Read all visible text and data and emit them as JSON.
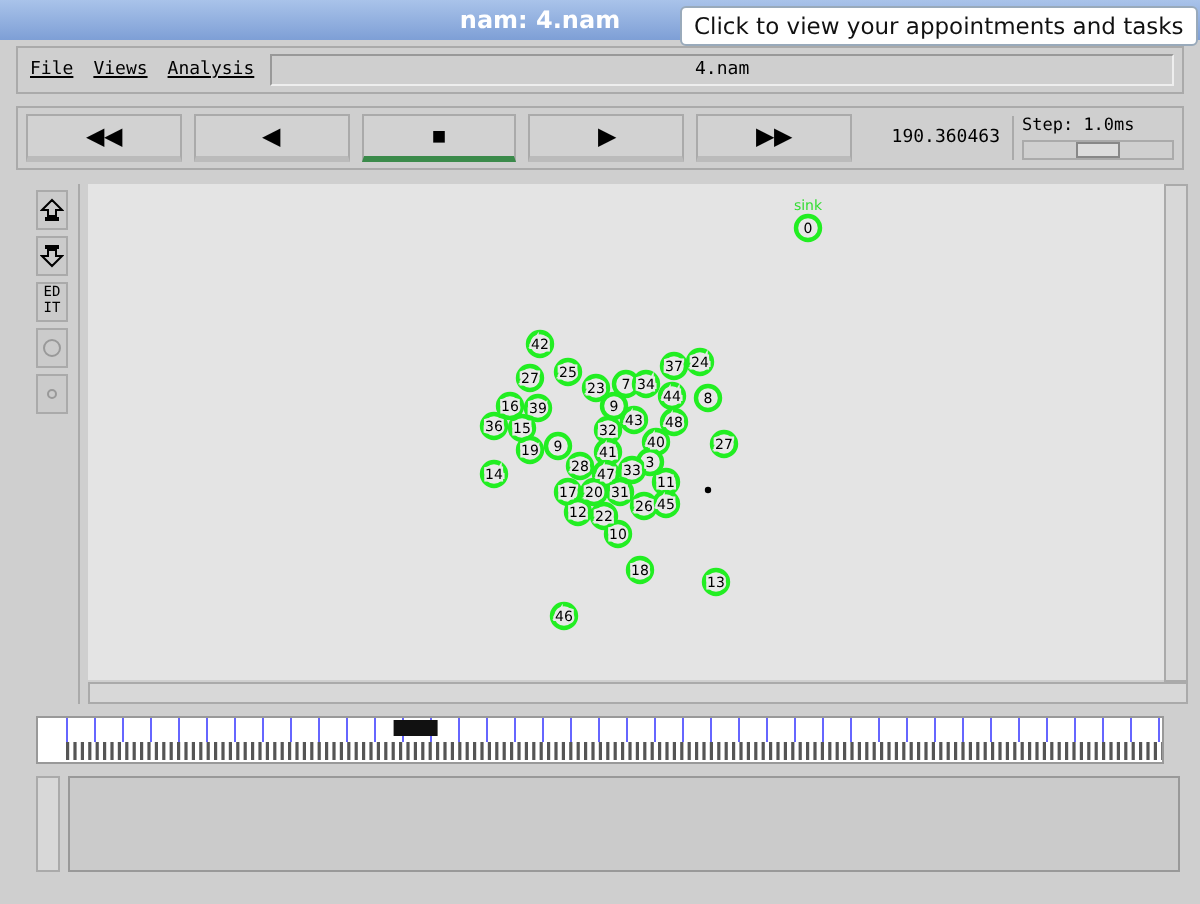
{
  "window": {
    "title": "nam: 4.nam"
  },
  "tooltip": {
    "text": "Click to view your appointments and tasks"
  },
  "menu": [
    "File",
    "Views",
    "Analysis"
  ],
  "file_field": {
    "value": "4.nam"
  },
  "playback": [
    {
      "symbol": "◀◀",
      "selected": false
    },
    {
      "symbol": "◀",
      "selected": false
    },
    {
      "symbol": "■",
      "selected": true
    },
    {
      "symbol": "▶",
      "selected": false
    },
    {
      "symbol": "▶▶",
      "selected": false
    }
  ],
  "time": "190.360463",
  "step": {
    "label": "Step: 1.0ms",
    "level": 0.5
  },
  "tools": [
    {
      "kind": "zoom-in"
    },
    {
      "kind": "zoom-out"
    },
    {
      "kind": "text",
      "label": "ED IT"
    },
    {
      "kind": "circle"
    },
    {
      "kind": "dot"
    }
  ],
  "nodes": [
    {
      "label": "0",
      "tag": "sink"
    },
    {
      "label": "42"
    },
    {
      "label": "27"
    },
    {
      "label": "25"
    },
    {
      "label": "37"
    },
    {
      "label": "24"
    },
    {
      "label": "23"
    },
    {
      "label": "7"
    },
    {
      "label": "9"
    },
    {
      "label": "34"
    },
    {
      "label": "44"
    },
    {
      "label": "8"
    },
    {
      "label": "43"
    },
    {
      "label": "48"
    },
    {
      "label": "16"
    },
    {
      "label": "39"
    },
    {
      "label": "36"
    },
    {
      "label": "15"
    },
    {
      "label": "19"
    },
    {
      "label": "9"
    },
    {
      "label": "32"
    },
    {
      "label": "41"
    },
    {
      "label": "40"
    },
    {
      "label": "27"
    },
    {
      "label": "3"
    },
    {
      "label": "14"
    },
    {
      "label": "28"
    },
    {
      "label": "47"
    },
    {
      "label": "33"
    },
    {
      "label": "17"
    },
    {
      "label": "20"
    },
    {
      "label": "31"
    },
    {
      "label": "11"
    },
    {
      "label": "12"
    },
    {
      "label": "22"
    },
    {
      "label": "26"
    },
    {
      "label": "45"
    },
    {
      "label": "10"
    },
    {
      "label": "18"
    },
    {
      "label": "13"
    },
    {
      "label": "46"
    }
  ],
  "timeline": {
    "level": 0.3
  }
}
